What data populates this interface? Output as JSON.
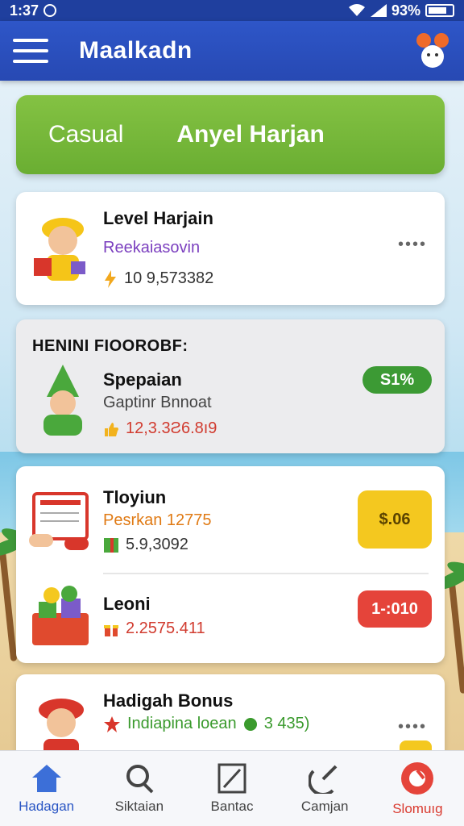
{
  "status_bar": {
    "time": "1:37",
    "battery": "93%"
  },
  "app_bar": {
    "title": "Maalkadn"
  },
  "banner": {
    "tab_casual": "Casual",
    "tab_active": "Anyel Harjan"
  },
  "cards": [
    {
      "title": "Level Harjain",
      "subtitle": "Reekaiasovin",
      "meta": "10 9,573382",
      "subtitle_color": "#7b3fbf"
    },
    {
      "section": "HENINI FIOOROBF:",
      "title": "Spepaian",
      "subtitle": "Gaptinr Bnnoat",
      "meta": "12,3.3Ƨ6.8ı9",
      "badge": "S1%",
      "badge_color": "#3c9a34"
    },
    {
      "title": "Tloyiun",
      "subtitle": "Pesrkan 12775",
      "meta": "5.9,3092",
      "button": "$.06",
      "button_color": "#f4c81f"
    },
    {
      "title": "Leoni",
      "meta": "2.2575.411",
      "button": "1-:010",
      "button_color": "#e5443a"
    },
    {
      "title": "Hadigah Bonus",
      "subtitle": "Indiapina loean",
      "amount": "3 435)"
    }
  ],
  "bottom_nav": [
    {
      "label": "Hadagan",
      "icon": "home-icon"
    },
    {
      "label": "Siktaian",
      "icon": "search-icon"
    },
    {
      "label": "Bantac",
      "icon": "edit-icon"
    },
    {
      "label": "Camjan",
      "icon": "satellite-icon"
    },
    {
      "label": "Slomuıg",
      "icon": "lifebuoy-icon"
    }
  ],
  "colors": {
    "primary": "#2a4fbf",
    "green": "#76b83a",
    "danger": "#e5443a",
    "yellow": "#f4c81f"
  }
}
